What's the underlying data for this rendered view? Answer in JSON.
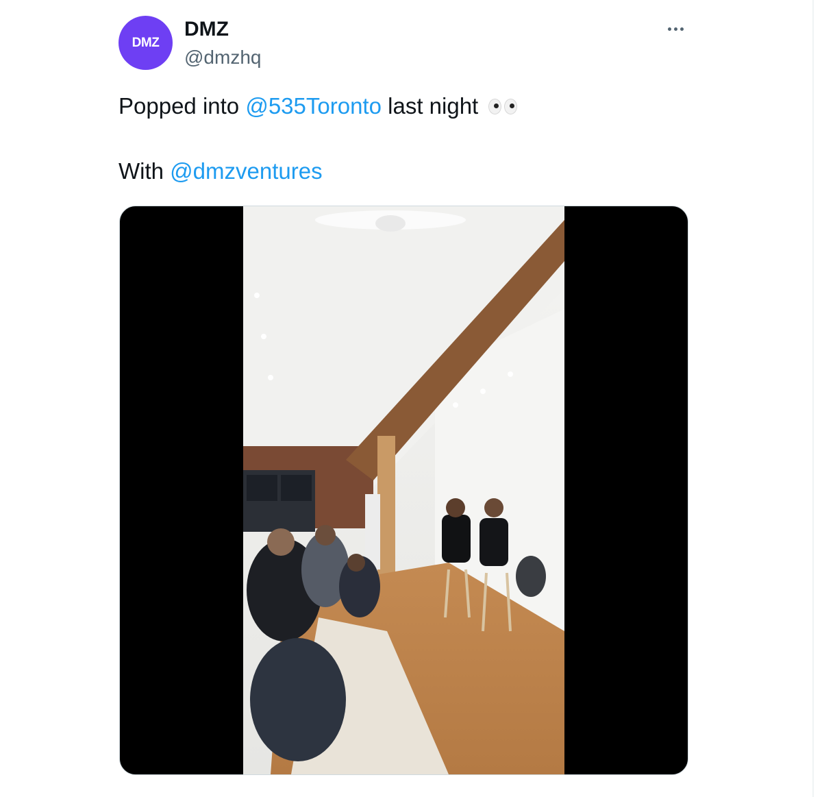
{
  "author": {
    "avatar_text": "DMZ",
    "display_name": "DMZ",
    "handle": "@dmzhq"
  },
  "tweet": {
    "line1_prefix": "Popped into ",
    "line1_mention": "@535Toronto",
    "line1_suffix": " last night",
    "line2_prefix": "With ",
    "line2_mention": "@dmzventures"
  },
  "icons": {
    "more": "more-horizontal-icon",
    "emoji": "eyes-emoji-icon"
  },
  "colors": {
    "avatar_bg": "#6e3ff3",
    "mention": "#1d9bf0",
    "text": "#0f1419",
    "secondary": "#536471"
  }
}
